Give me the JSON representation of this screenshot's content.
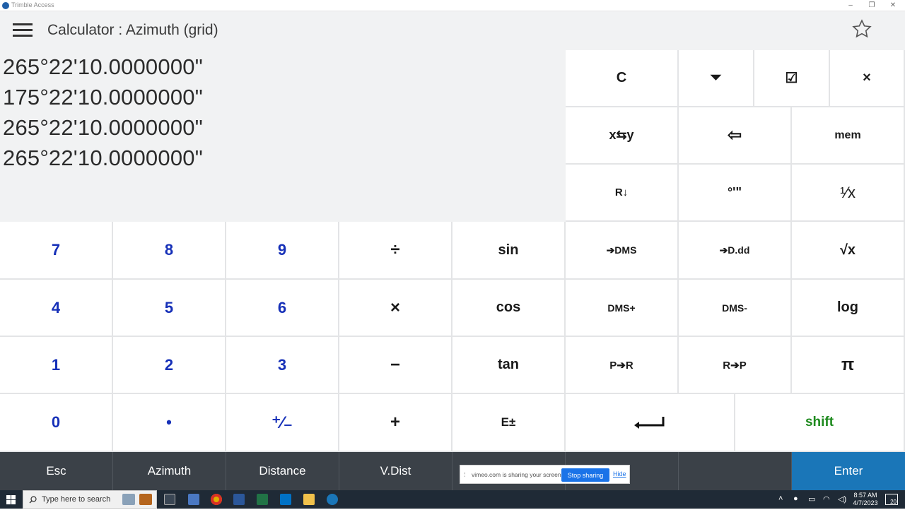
{
  "window": {
    "title": "Trimble Access",
    "minimize_glyph": "–",
    "restore_glyph": "❐",
    "close_glyph": "✕"
  },
  "header": {
    "title": "Calculator : Azimuth (grid)",
    "star_icon": "star-outline-icon"
  },
  "display": {
    "stack": [
      "265°22'10.0000000\"",
      "175°22'10.0000000\"",
      "265°22'10.0000000\"",
      "265°22'10.0000000\""
    ]
  },
  "keys": {
    "clear": "C",
    "dropdown_glyph": "⏷",
    "checkbox_glyph": "☑",
    "close_glyph": "×",
    "swap": "x⇆y",
    "backspace_glyph": "⇦",
    "mem": "mem",
    "roll_down": "R↓",
    "dms_symbols": "°'\"",
    "reciprocal": "¹⁄x",
    "to_dms": "➔DMS",
    "to_ddd": "➔D.dd",
    "sqrt": "√x",
    "dms_plus": "DMS+",
    "dms_minus": "DMS-",
    "log": "log",
    "p_to_r": "P➔R",
    "r_to_p": "R➔P",
    "pi": "π",
    "sin": "sin",
    "cos": "cos",
    "tan": "tan",
    "e_exp": "E±",
    "divide": "÷",
    "multiply": "×",
    "minus": "−",
    "plus": "+",
    "enter_key_glyph": "↵",
    "shift": "shift",
    "n7": "7",
    "n8": "8",
    "n9": "9",
    "n4": "4",
    "n5": "5",
    "n6": "6",
    "n1": "1",
    "n2": "2",
    "n3": "3",
    "n0": "0",
    "dot": "•",
    "plusminus": "⁺⁄₋"
  },
  "softkeys": {
    "esc": "Esc",
    "azimuth": "Azimuth",
    "distance": "Distance",
    "vdist": "V.Dist",
    "enter": "Enter"
  },
  "share_bar": {
    "message": "vimeo.com is sharing your screen.",
    "stop_label": "Stop sharing",
    "hide_label": "Hide"
  },
  "taskbar": {
    "search_placeholder": "Type here to search",
    "time": "8:57 AM",
    "date": "4/7/2023",
    "notification_count": "20"
  },
  "colors": {
    "digit_blue": "#1630b8",
    "shift_green": "#1e8a1e",
    "enter_blue": "#1a76b8",
    "softkey_bar": "#3b4148"
  }
}
